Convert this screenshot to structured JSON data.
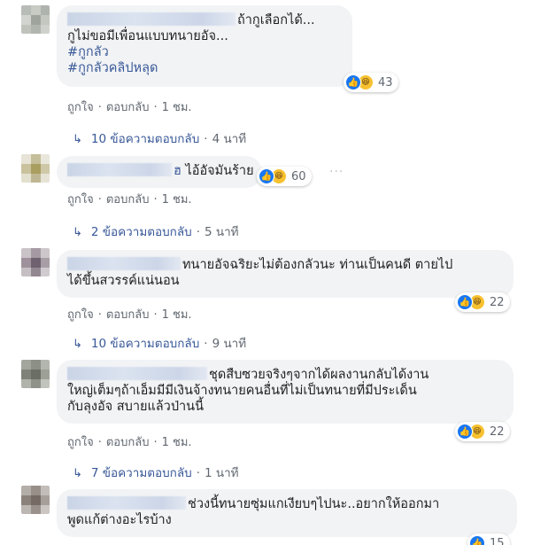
{
  "comments": [
    {
      "id": "c1",
      "lines": [
        "ถ้ากูเลือกได้...",
        "กูไม่ขอมีเพื่อนแบบทนายอัจ..."
      ],
      "hashtags": [
        "#กูกลัว",
        "#กูกลัวคลิปหลุด"
      ],
      "reaction_count": "43",
      "like_label": "ถูกใจ",
      "reply_label": "ตอบกลับ",
      "time": "1 ชม.",
      "replies_text": "10 ข้อความตอบกลับ",
      "replies_time": "4 นาที"
    },
    {
      "id": "c2",
      "author_tail": "ฮ",
      "lines": [
        "ไอ้อัจมันร้าย"
      ],
      "reaction_count": "60",
      "like_label": "ถูกใจ",
      "reply_label": "ตอบกลับ",
      "time": "1 ชม.",
      "replies_text": "2 ข้อความตอบกลับ",
      "replies_time": "5 นาที",
      "more_icon": "···"
    },
    {
      "id": "c3",
      "lines": [
        "ทนายอัจฉริยะไม่ต้องกลัวนะ ท่านเป็นคนดี ตายไป",
        "ได้ขึ้นสวรรค์แน่นอน"
      ],
      "reaction_count": "22",
      "like_label": "ถูกใจ",
      "reply_label": "ตอบกลับ",
      "time": "1 ชม.",
      "replies_text": "10 ข้อความตอบกลับ",
      "replies_time": "9 นาที"
    },
    {
      "id": "c4",
      "lines": [
        "ชุดสืบซวยจริงๆจากได้ผลงานกลับได้งาน",
        "ใหญ่เต็มๆถ้าเอ็มมีมีเงินจ้างทนายคนอื่นที่ไม่เป็นทนายที่มีประเด็น",
        "กับลุงอัจ สบายแล้วป่านนี้"
      ],
      "reaction_count": "22",
      "like_label": "ถูกใจ",
      "reply_label": "ตอบกลับ",
      "time": "1 ชม.",
      "replies_text": "7 ข้อความตอบกลับ",
      "replies_time": "1 นาที"
    },
    {
      "id": "c5",
      "lines": [
        "ช่วงนี้ทนายซุ่มแกเงียบๆไปนะ..อยากให้ออกมา",
        "พูดแก้ต่างอะไรบ้าง"
      ],
      "reaction_count": "15"
    }
  ],
  "separator": "·",
  "reply_arrow": "↳",
  "icons": {
    "like": "thumbs-up-icon",
    "haha": "haha-emoji-icon"
  },
  "colors": {
    "link": "#385898",
    "like_blue": "#1877f2",
    "haha_yellow": "#f7c12f",
    "bubble": "#f2f3f5"
  }
}
